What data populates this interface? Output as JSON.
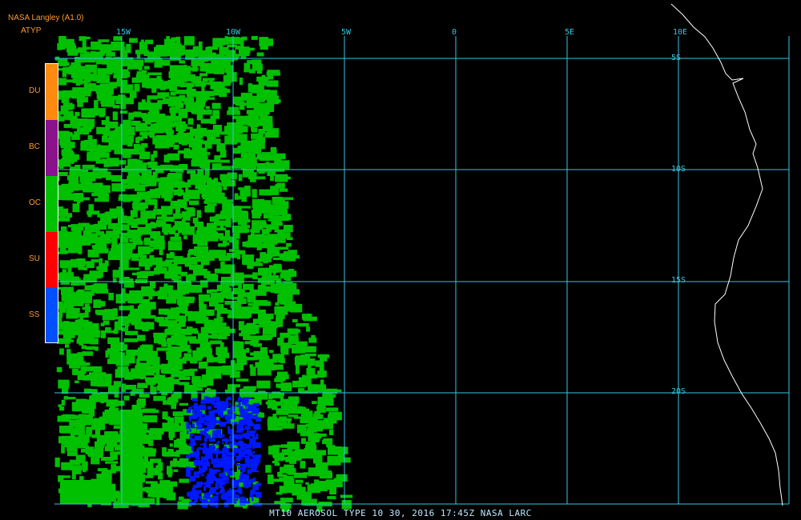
{
  "header": {
    "source": "NASA Langley (A1.0)",
    "product": "ATYP"
  },
  "legend": [
    {
      "code": "DU",
      "color": "#ff8a10"
    },
    {
      "code": "BC",
      "color": "#8a138c"
    },
    {
      "code": "OC",
      "color": "#00c000"
    },
    {
      "code": "SU",
      "color": "#ff0000"
    },
    {
      "code": "SS",
      "color": "#0050ff"
    }
  ],
  "map": {
    "longitude_labels": [
      "15W",
      "10W",
      "5W",
      "0",
      "5E",
      "10E"
    ],
    "latitude_labels": [
      "5S",
      "10S",
      "15S",
      "20S"
    ],
    "grid_color": "#36c6e2",
    "coastline_color": "#ffffff"
  },
  "footer": {
    "caption": "MT10  AEROSOL TYPE   10 30, 2016 17:45Z   NASA LARC"
  }
}
